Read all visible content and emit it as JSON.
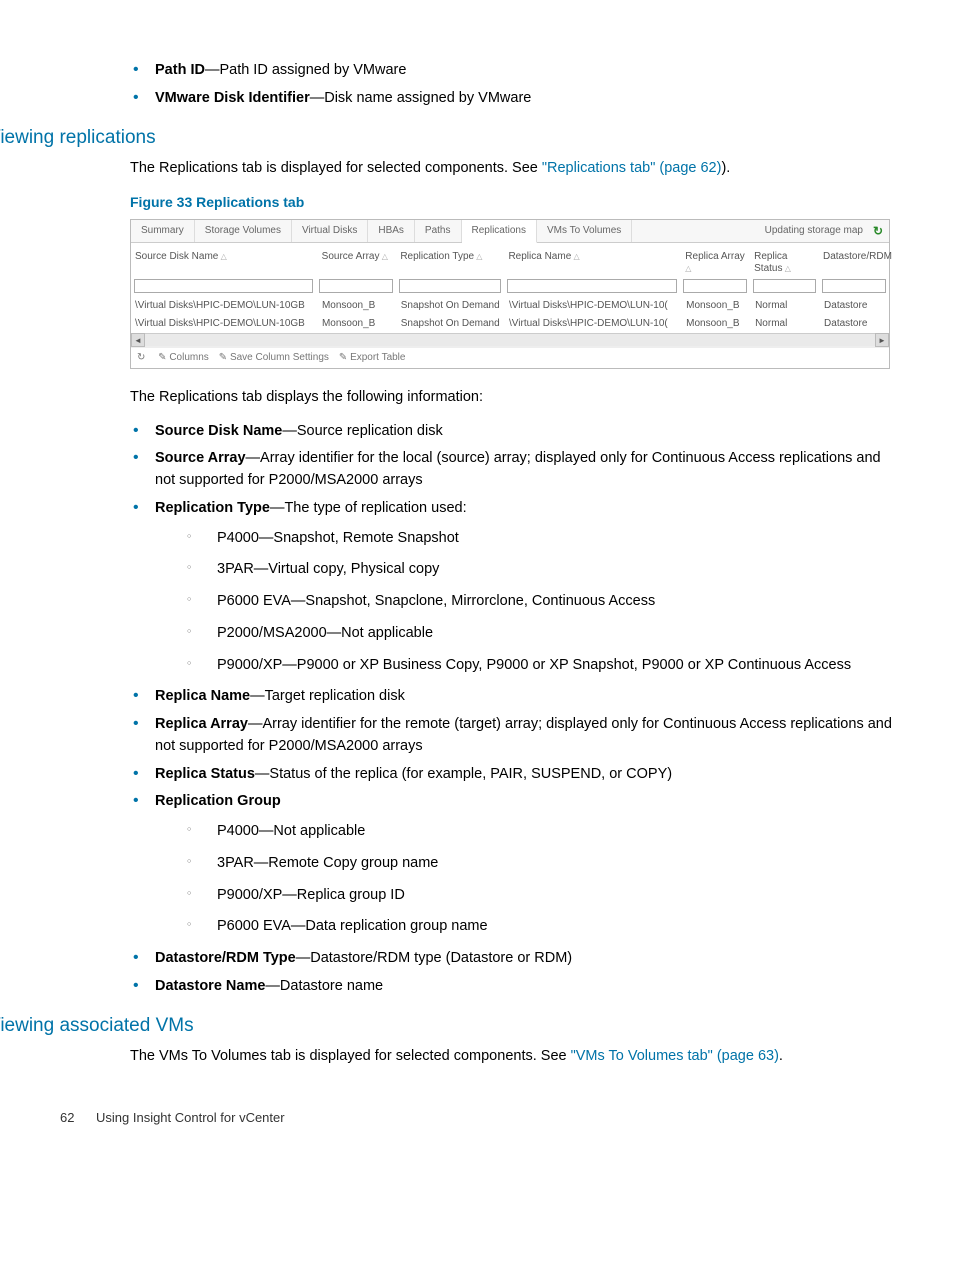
{
  "intro_bullets": [
    {
      "term": "Path ID",
      "desc": "—Path ID assigned by VMware"
    },
    {
      "term": "VMware Disk Identifier",
      "desc": "—Disk name assigned by VMware"
    }
  ],
  "section1": {
    "heading": "Viewing replications",
    "intro_before": "The Replications tab is displayed for selected components.  See ",
    "intro_link": "\"Replications tab\" (page 62)",
    "intro_after": ").",
    "figcap": "Figure 33 Replications tab",
    "after_fig": "The Replications tab displays the following information:"
  },
  "screenshot": {
    "tabs": [
      "Summary",
      "Storage Volumes",
      "Virtual Disks",
      "HBAs",
      "Paths",
      "Replications",
      "VMs To Volumes"
    ],
    "active_tab": 5,
    "status": "Updating storage map",
    "headers": [
      "Source Disk Name",
      "Source Array",
      "Replication Type",
      "Replica Name",
      "Replica Array",
      "Replica Status",
      "Datastore/RDM"
    ],
    "rows": [
      [
        "\\Virtual Disks\\HPIC-DEMO\\LUN-10GB",
        "Monsoon_B",
        "Snapshot On Demand",
        "\\Virtual Disks\\HPIC-DEMO\\LUN-10(",
        "Monsoon_B",
        "Normal",
        "Datastore"
      ],
      [
        "\\Virtual Disks\\HPIC-DEMO\\LUN-10GB",
        "Monsoon_B",
        "Snapshot On Demand",
        "\\Virtual Disks\\HPIC-DEMO\\LUN-10(",
        "Monsoon_B",
        "Normal",
        "Datastore"
      ]
    ],
    "footer_links": [
      "Columns",
      "Save Column Settings",
      "Export Table"
    ]
  },
  "rep_bullets": [
    {
      "term": "Source Disk Name",
      "desc": "—Source replication disk"
    },
    {
      "term": "Source Array",
      "desc": "—Array identifier for the local (source) array; displayed only for Continuous Access replications and not supported for P2000/MSA2000 arrays"
    },
    {
      "term": "Replication Type",
      "desc": "—The type of replication used:",
      "subs": [
        "P4000—Snapshot, Remote Snapshot",
        "3PAR—Virtual copy, Physical copy",
        "P6000 EVA—Snapshot, Snapclone, Mirrorclone, Continuous Access",
        "P2000/MSA2000—Not applicable",
        "P9000/XP—P9000 or XP Business Copy, P9000 or XP Snapshot, P9000 or XP Continuous Access"
      ]
    },
    {
      "term": "Replica Name",
      "desc": "—Target replication disk"
    },
    {
      "term": "Replica Array",
      "desc": "—Array identifier for the remote (target) array; displayed only for Continuous Access replications and not supported for P2000/MSA2000 arrays"
    },
    {
      "term": "Replica Status",
      "desc": "—Status of the replica (for example, PAIR, SUSPEND, or COPY)"
    },
    {
      "term": "Replication Group",
      "desc": "",
      "subs": [
        "P4000—Not applicable",
        "3PAR—Remote Copy group name",
        "P9000/XP—Replica group ID",
        "P6000 EVA—Data replication group name"
      ]
    },
    {
      "term": "Datastore/RDM Type",
      "desc": "—Datastore/RDM type (Datastore or RDM)"
    },
    {
      "term": "Datastore Name",
      "desc": "—Datastore name"
    }
  ],
  "section2": {
    "heading": "Viewing associated VMs",
    "intro_before": "The VMs To Volumes tab is displayed for selected components.  See ",
    "intro_link": "\"VMs To Volumes tab\" (page 63)",
    "intro_after": "."
  },
  "footer": {
    "page": "62",
    "title": "Using Insight Control for vCenter"
  }
}
